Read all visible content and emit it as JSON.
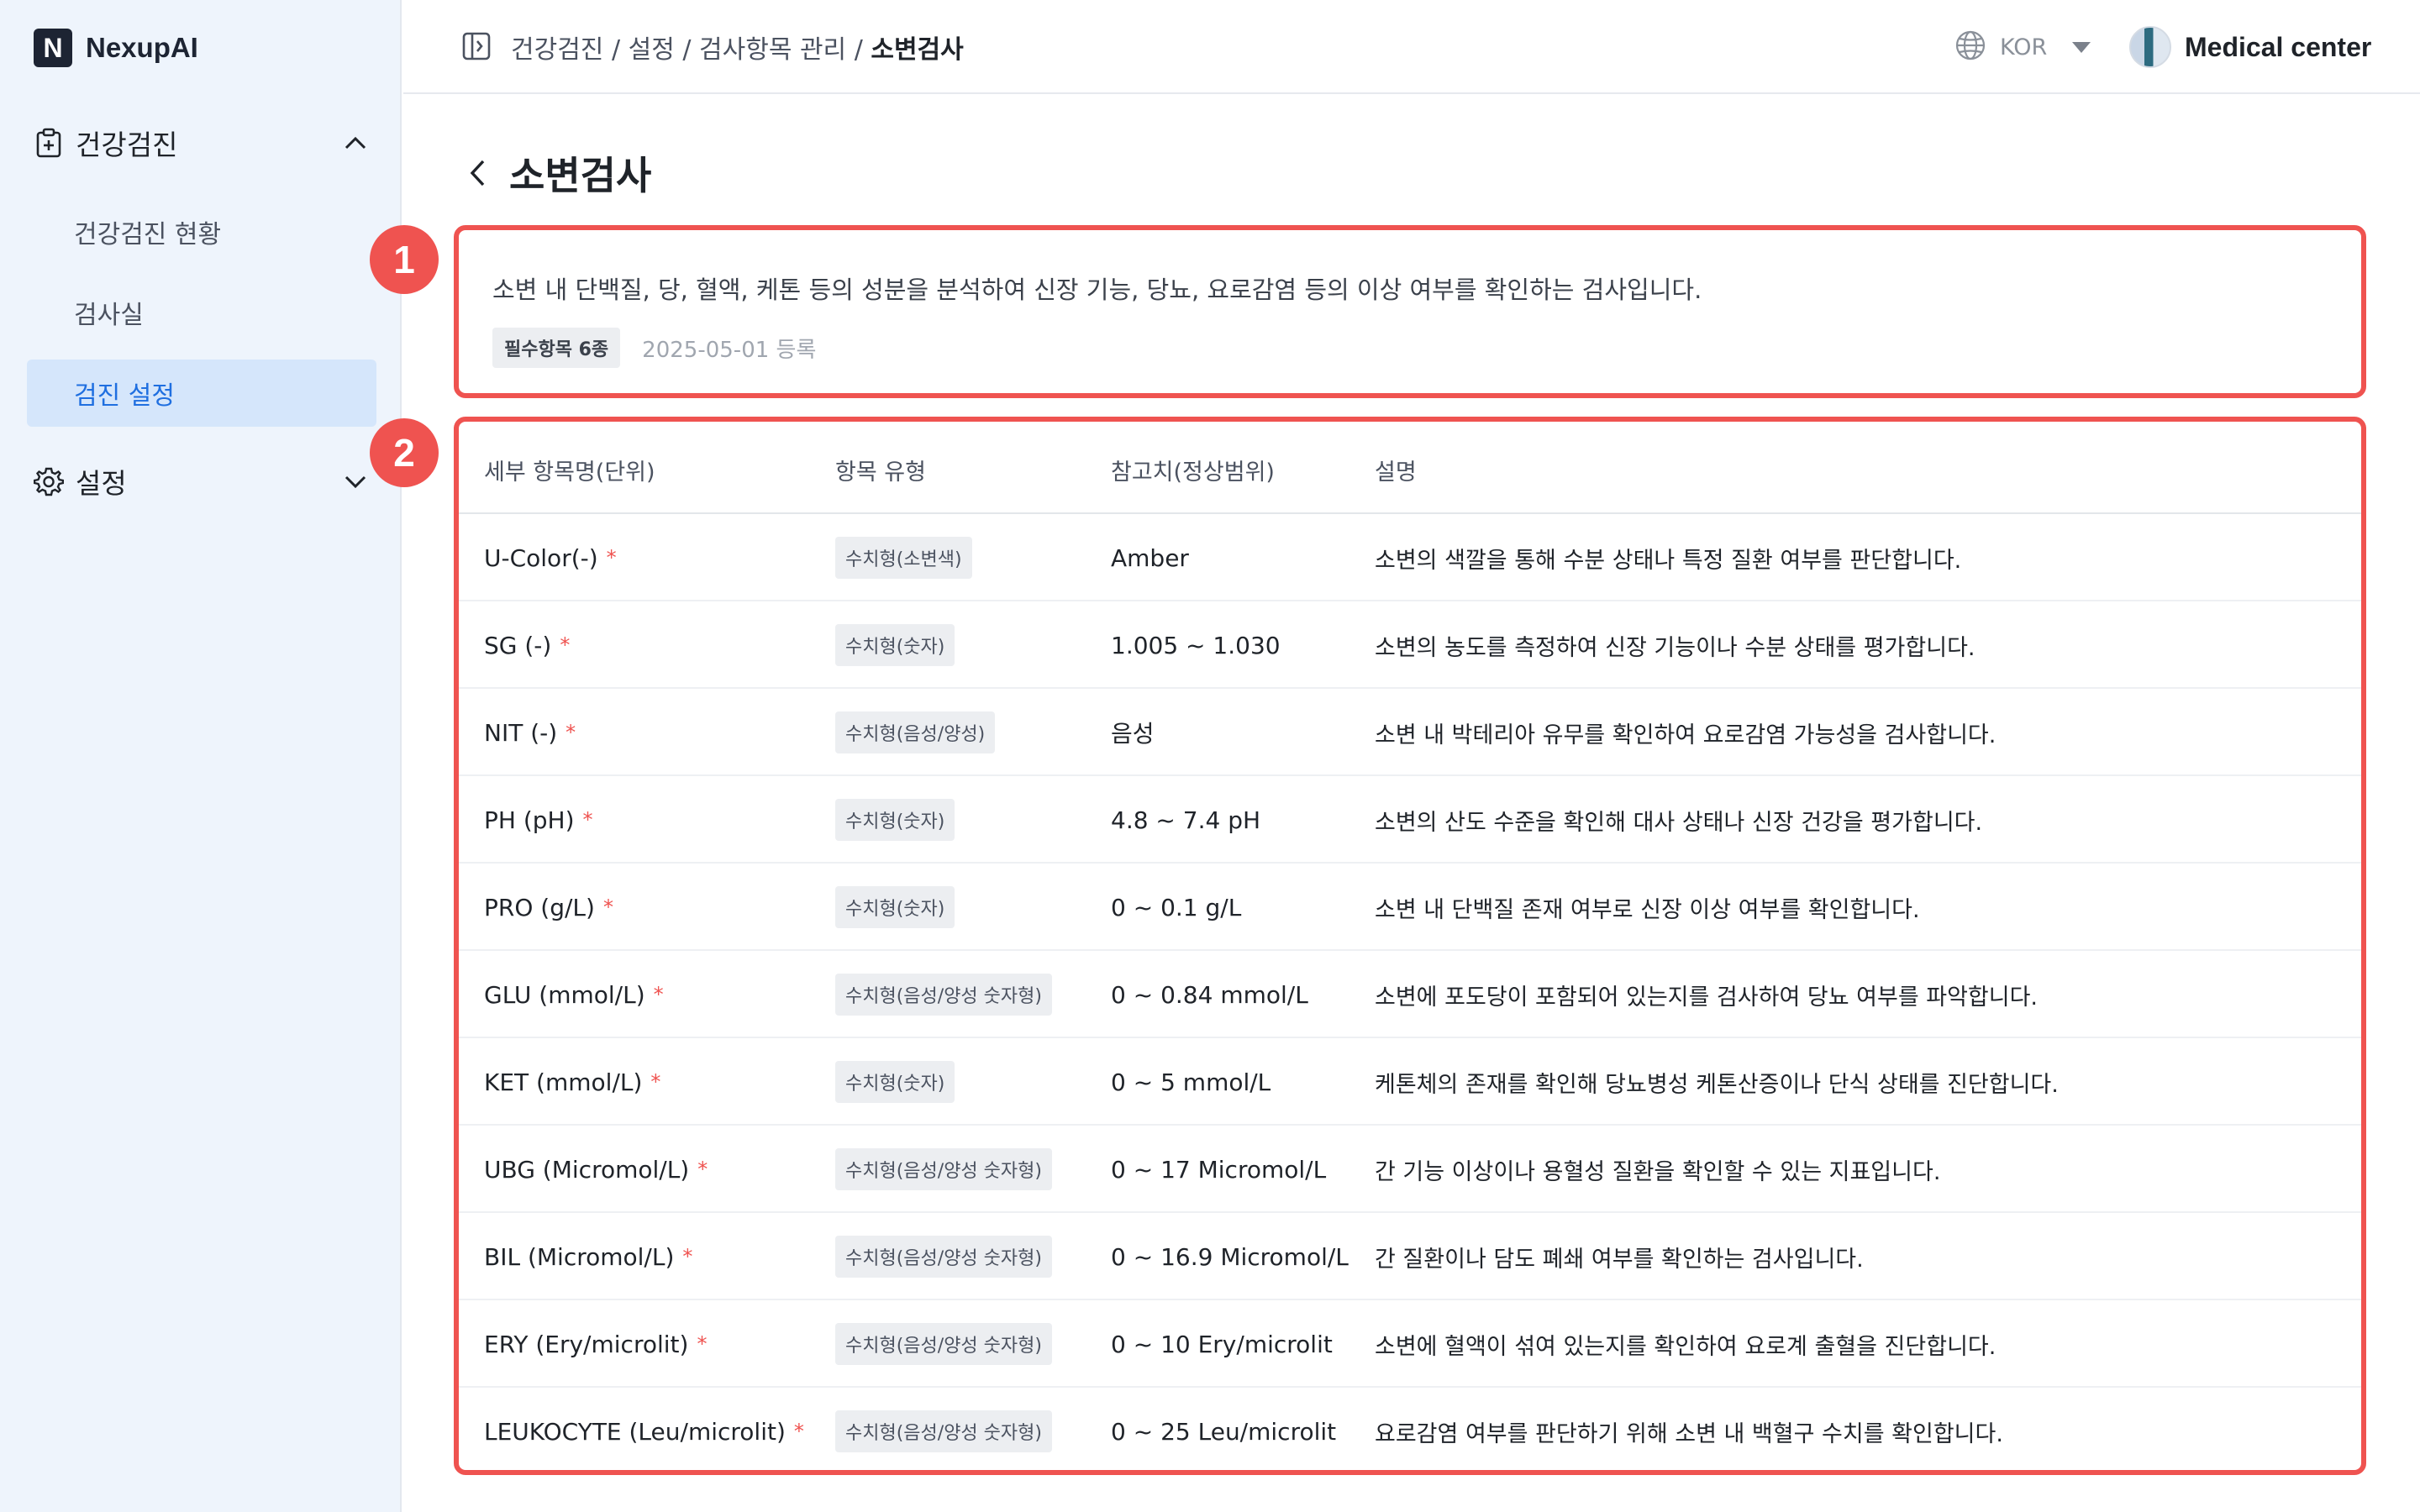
{
  "app": {
    "name": "NexupAI",
    "logo_letter": "N"
  },
  "sidebar": {
    "groups": [
      {
        "label": "건강검진",
        "icon": "clipboard-plus-icon",
        "expanded": true,
        "items": [
          {
            "label": "건강검진 현황",
            "active": false
          },
          {
            "label": "검사실",
            "active": false
          },
          {
            "label": "검진 설정",
            "active": true
          }
        ]
      },
      {
        "label": "설정",
        "icon": "gear-icon",
        "expanded": false,
        "items": []
      }
    ]
  },
  "topbar": {
    "breadcrumb": [
      "건강검진",
      "설정",
      "검사항목 관리",
      "소변검사"
    ],
    "language": "KOR",
    "user_name": "Medical center"
  },
  "page": {
    "title": "소변검사",
    "description": "소변 내 단백질, 당, 혈액, 케톤 등의 성분을 분석하여 신장 기능, 당뇨, 요로감염 등의 이상 여부를 확인하는 검사입니다.",
    "required_badge": "필수항목 6종",
    "registered": "2025-05-01 등록"
  },
  "markers": [
    "1",
    "2"
  ],
  "table": {
    "headers": [
      "세부 항목명(단위)",
      "항목 유형",
      "참고치(정상범위)",
      "설명"
    ],
    "rows": [
      {
        "name": "U-Color(-)",
        "required": "*",
        "type": "수치형(소변색)",
        "reference": "Amber",
        "description": "소변의 색깔을 통해 수분 상태나 특정 질환 여부를 판단합니다."
      },
      {
        "name": "SG (-)",
        "required": "*",
        "type": "수치형(숫자)",
        "reference": "1.005 ~ 1.030",
        "description": "소변의 농도를 측정하여 신장 기능이나 수분 상태를 평가합니다."
      },
      {
        "name": "NIT (-)",
        "required": "*",
        "type": "수치형(음성/양성)",
        "reference": "음성",
        "description": "소변 내 박테리아 유무를 확인하여 요로감염 가능성을 검사합니다."
      },
      {
        "name": "PH (pH)",
        "required": "*",
        "type": "수치형(숫자)",
        "reference": "4.8 ~ 7.4 pH",
        "description": "소변의 산도 수준을 확인해 대사 상태나 신장 건강을 평가합니다."
      },
      {
        "name": "PRO (g/L)",
        "required": "*",
        "type": "수치형(숫자)",
        "reference": "0 ~ 0.1 g/L",
        "description": "소변 내 단백질 존재 여부로 신장 이상 여부를 확인합니다."
      },
      {
        "name": "GLU (mmol/L)",
        "required": "*",
        "type": "수치형(음성/양성 숫자형)",
        "reference": "0 ~ 0.84 mmol/L",
        "description": "소변에 포도당이 포함되어 있는지를 검사하여 당뇨 여부를 파악합니다."
      },
      {
        "name": "KET (mmol/L)",
        "required": "*",
        "type": "수치형(숫자)",
        "reference": "0 ~ 5 mmol/L",
        "description": "케톤체의 존재를 확인해 당뇨병성 케톤산증이나 단식 상태를 진단합니다."
      },
      {
        "name": "UBG (Micromol/L)",
        "required": "*",
        "type": "수치형(음성/양성 숫자형)",
        "reference": "0 ~ 17 Micromol/L",
        "description": "간 기능 이상이나 용혈성 질환을 확인할 수 있는 지표입니다."
      },
      {
        "name": "BIL (Micromol/L)",
        "required": "*",
        "type": "수치형(음성/양성 숫자형)",
        "reference": "0 ~ 16.9 Micromol/L",
        "description": "간 질환이나 담도 폐쇄 여부를 확인하는 검사입니다."
      },
      {
        "name": "ERY (Ery/microlit)",
        "required": "*",
        "type": "수치형(음성/양성 숫자형)",
        "reference": "0 ~ 10 Ery/microlit",
        "description": "소변에 혈액이 섞여 있는지를 확인하여 요로계 출혈을 진단합니다."
      },
      {
        "name": "LEUKOCYTE (Leu/microlit)",
        "required": "*",
        "type": "수치형(음성/양성 숫자형)",
        "reference": "0 ~ 25 Leu/microlit",
        "description": "요로감염 여부를 판단하기 위해 소변 내 백혈구 수치를 확인합니다."
      }
    ]
  },
  "colors": {
    "accent": "#1f6fe0",
    "active_bg": "#d5e6fb",
    "sidebar_bg": "#eef4fc",
    "highlight": "#ef5350"
  }
}
